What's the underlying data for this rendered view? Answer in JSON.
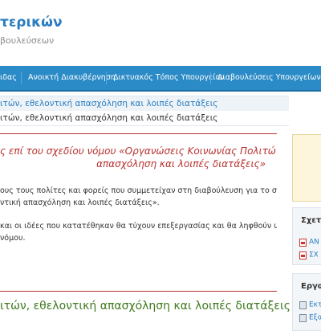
{
  "header": {
    "title": "τερικών",
    "subtitle": "βουλεύσεων"
  },
  "nav": {
    "items": [
      {
        "label": "ιδας"
      },
      {
        "label": "Ανοικτή Διακυβέρνηση"
      },
      {
        "label": "Δικτυακός Τόπος Υπουργείου"
      },
      {
        "label": "Διαβουλεύσεις Υπουργείων"
      }
    ]
  },
  "breadcrumb": {
    "text": "ιτών, εθελοντική απασχόληση και λοιπές διατάξεις"
  },
  "page_heading": {
    "text": "ιτών, εθελοντική απασχόληση και λοιπές διατάξεις"
  },
  "article": {
    "title_line1": "ς επί του σχεδίου νόμου «Οργανώσεις Κοινωνίας Πολιτών, εθελοντική",
    "title_line2": "απασχόληση και λοιπές διατάξεις»",
    "para1_line1": "ους τους πολίτες και φορείς που συμμετείχαν στη διαβούλευση για το σχέδιο νόμου με τίτλο",
    "para1_line2": "ντική απασχόληση και λοιπές διατάξεις».",
    "para2_line1": "και οι ιδέες που κατατέθηκαν θα τύχουν επεξεργασίας και θα ληφθούν υπόψη, προκειμένου",
    "para2_line2": "νόμου.",
    "section_title": "ιτών, εθελοντική απασχόληση και λοιπές διατάξεις"
  },
  "sidebar": {
    "related": {
      "heading": "Σχετι",
      "links": [
        {
          "label": "ΑΝ",
          "icon": "pdf-icon"
        },
        {
          "label": "ΣΧ",
          "icon": "pdf-icon"
        }
      ]
    },
    "tools": {
      "heading": "Εργαλ",
      "links": [
        {
          "label": "Εκτ",
          "icon": "print-icon"
        },
        {
          "label": "Εξα",
          "icon": "export-icon"
        }
      ]
    }
  },
  "colors": {
    "nav_bg": "#2b8bc6",
    "title_blue": "#2a7dc0",
    "article_red": "#b8312f",
    "section_green": "#3f7a1f",
    "highlight_box": "#fdf6dc"
  }
}
